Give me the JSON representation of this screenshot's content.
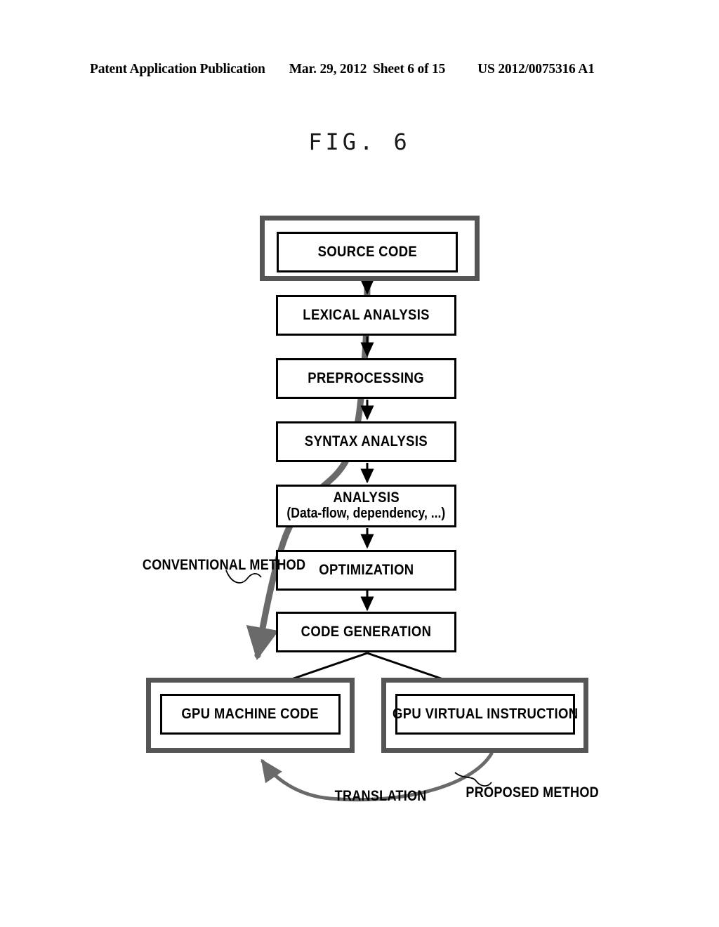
{
  "header": {
    "publication": "Patent Application Publication",
    "date": "Mar. 29, 2012",
    "sheet": "Sheet 6 of 15",
    "number": "US 2012/0075316 A1"
  },
  "figure": {
    "title": "FIG. 6"
  },
  "flow": {
    "source_code": "SOURCE CODE",
    "lexical_analysis": "LEXICAL ANALYSIS",
    "preprocessing": "PREPROCESSING",
    "syntax_analysis": "SYNTAX ANALYSIS",
    "analysis_line1": "ANALYSIS",
    "analysis_line2": "(Data-flow, dependency, ...)",
    "optimization": "OPTIMIZATION",
    "code_generation": "CODE GENERATION",
    "gpu_machine_code": "GPU MACHINE CODE",
    "gpu_virtual_instruction": "GPU VIRTUAL INSTRUCTION"
  },
  "annotations": {
    "conventional_method": "CONVENTIONAL METHOD",
    "translation": "TRANSLATION",
    "proposed_method": "PROPOSED METHOD"
  },
  "colors": {
    "ink": "#000000",
    "emphasis_frame": "#555555",
    "highlight_path": "#666666"
  }
}
